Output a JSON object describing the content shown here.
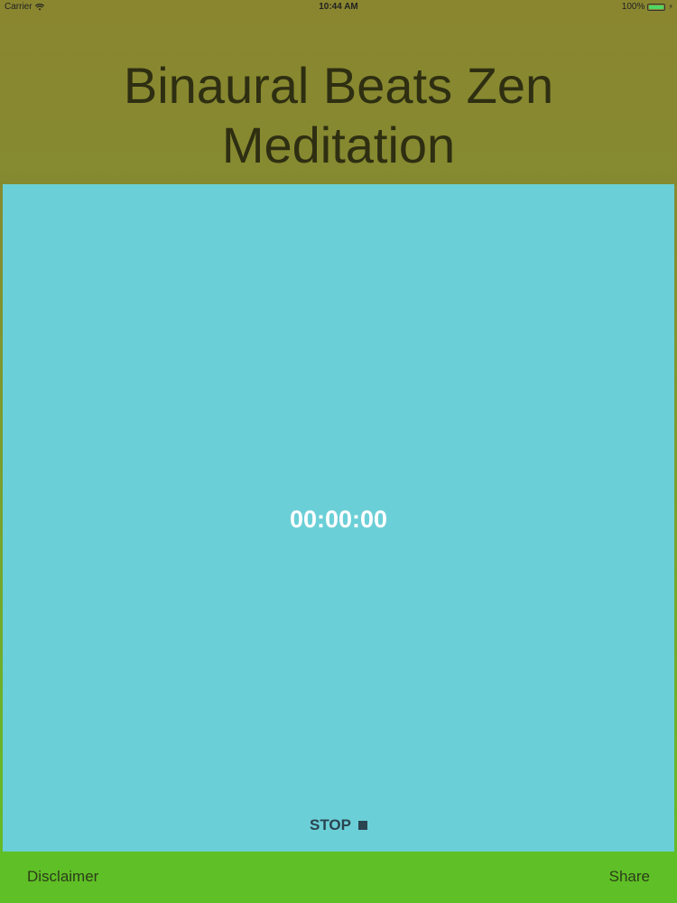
{
  "status_bar": {
    "carrier": "Carrier",
    "time": "10:44 AM",
    "battery": "100%",
    "battery_level": 1.0
  },
  "header": {
    "title_line1": "Binaural Beats Zen",
    "title_line2": "Meditation"
  },
  "player": {
    "timer": "00:00:00",
    "stop_label": "STOP"
  },
  "footer": {
    "disclaimer_label": "Disclaimer",
    "share_label": "Share"
  },
  "colors": {
    "header_bg": "#858a30",
    "panel_bg": "#6bcfd7",
    "footer_bg": "#5fbf26"
  },
  "icons": {
    "wifi": "wifi-icon",
    "battery": "battery-icon",
    "stop": "stop-icon"
  }
}
